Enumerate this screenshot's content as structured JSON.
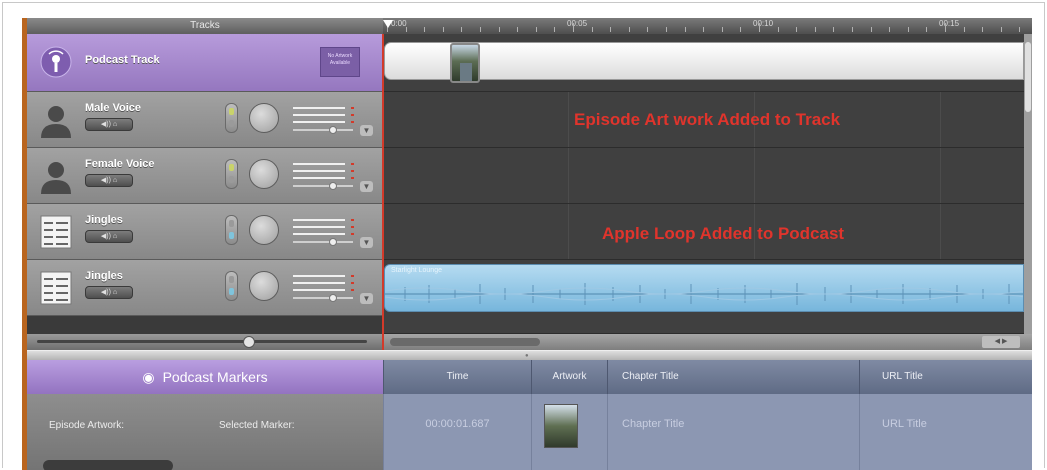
{
  "header": {
    "tracks_label": "Tracks"
  },
  "ruler": {
    "labels": [
      "0:00",
      "00:05",
      "00:10",
      "00:15"
    ]
  },
  "tracks": [
    {
      "name": "Podcast Track",
      "artwork_text": "No Artwork Available"
    },
    {
      "name": "Male Voice",
      "btn": "◀))  ⌂"
    },
    {
      "name": "Female Voice",
      "btn": "◀))  ⌂"
    },
    {
      "name": "Jingles",
      "btn": "◀))  ⌂"
    },
    {
      "name": "Jingles",
      "btn": "◀))  ⌂"
    }
  ],
  "timeline": {
    "annotation_artwork": "Episode Art work Added to Track",
    "annotation_loop": "Apple Loop Added to Podcast",
    "loop_title": "Starlight Lounge"
  },
  "markers": {
    "title": "Podcast Markers",
    "columns": [
      "Time",
      "Artwork",
      "Chapter Title",
      "URL Title"
    ],
    "episode_artwork_label": "Episode Artwork:",
    "selected_marker_label": "Selected Marker:",
    "row": {
      "time": "00:00:01.687",
      "chapter_title": "Chapter Title",
      "url_title": "URL Title"
    }
  },
  "colors": {
    "podcast_purple": "#a58ad0",
    "playhead_red": "#d23a2a",
    "annotation_red": "#e0342c",
    "loop_blue": "#8fc6e6"
  }
}
